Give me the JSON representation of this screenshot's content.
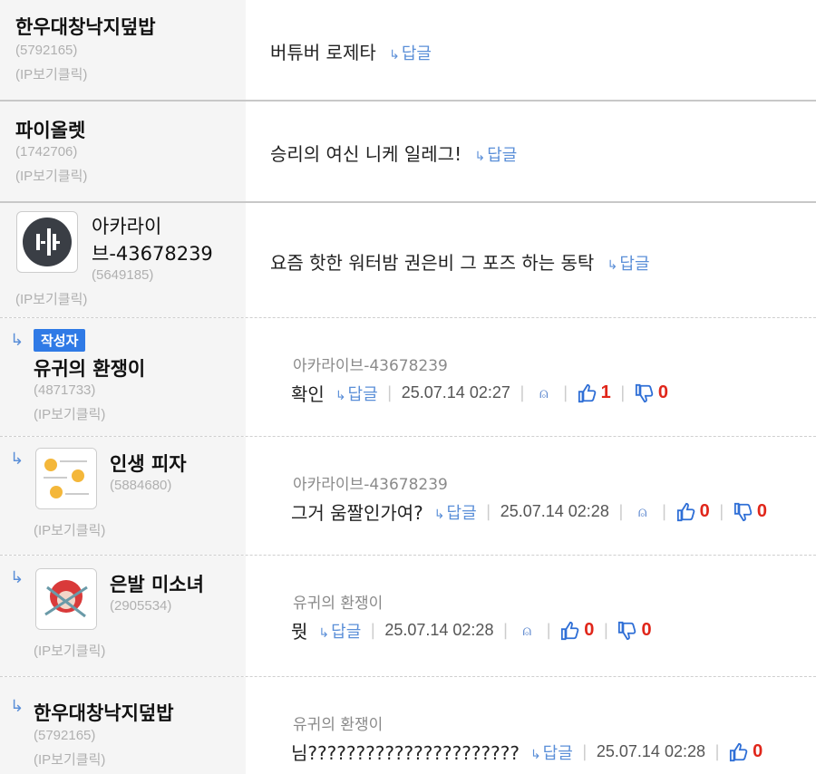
{
  "comments": [
    {
      "nick": "한우대창낙지덮밥",
      "uid": "(5792165)",
      "ip": "(IP보기클릭)",
      "content": "버튜버 로제타",
      "reply": "답글"
    },
    {
      "nick": "파이올렛",
      "uid": "(1742706)",
      "ip": "(IP보기클릭)",
      "content": "승리의 여신 니케 일레그!",
      "reply": "답글"
    },
    {
      "nick1": "아카라이",
      "nick2": "브-43678239",
      "uid": "(5649185)",
      "ip": "(IP보기클릭)",
      "content": "요즘 핫한 워터밤 권은비 그 포즈 하는 동탁",
      "reply": "답글"
    },
    {
      "badge": "작성자",
      "nick": "유귀의 환쟁이",
      "uid": "(4871733)",
      "ip": "(IP보기클릭)",
      "ref": "아카라이브-43678239",
      "content": "확인",
      "reply": "답글",
      "date": "25.07.14 02:27",
      "up": "1",
      "down": "0"
    },
    {
      "nick": "인생 피자",
      "uid": "(5884680)",
      "ip": "(IP보기클릭)",
      "ref": "아카라이브-43678239",
      "content": "그거 움짤인가여?",
      "reply": "답글",
      "date": "25.07.14 02:28",
      "up": "0",
      "down": "0"
    },
    {
      "nick": "은발 미소녀",
      "uid": "(2905534)",
      "ip": "(IP보기클릭)",
      "ref": "유귀의 환쟁이",
      "content": "뭣",
      "reply": "답글",
      "date": "25.07.14 02:28",
      "up": "0",
      "down": "0"
    },
    {
      "nick": "한우대창낙지덮밥",
      "uid": "(5792165)",
      "ip": "(IP보기클릭)",
      "ref": "유귀의 환쟁이",
      "content": "님??????????????????????",
      "reply": "답글",
      "date": "25.07.14 02:28",
      "up": "0"
    }
  ],
  "colors": {
    "accent": "#2f7ae6",
    "reply": "#5b8fd8",
    "count": "#e0261a"
  },
  "icons": {
    "reply": "reply-arrow-icon",
    "bell": "alarm-bell-icon",
    "up": "thumbs-up-icon",
    "down": "thumbs-down-icon"
  }
}
